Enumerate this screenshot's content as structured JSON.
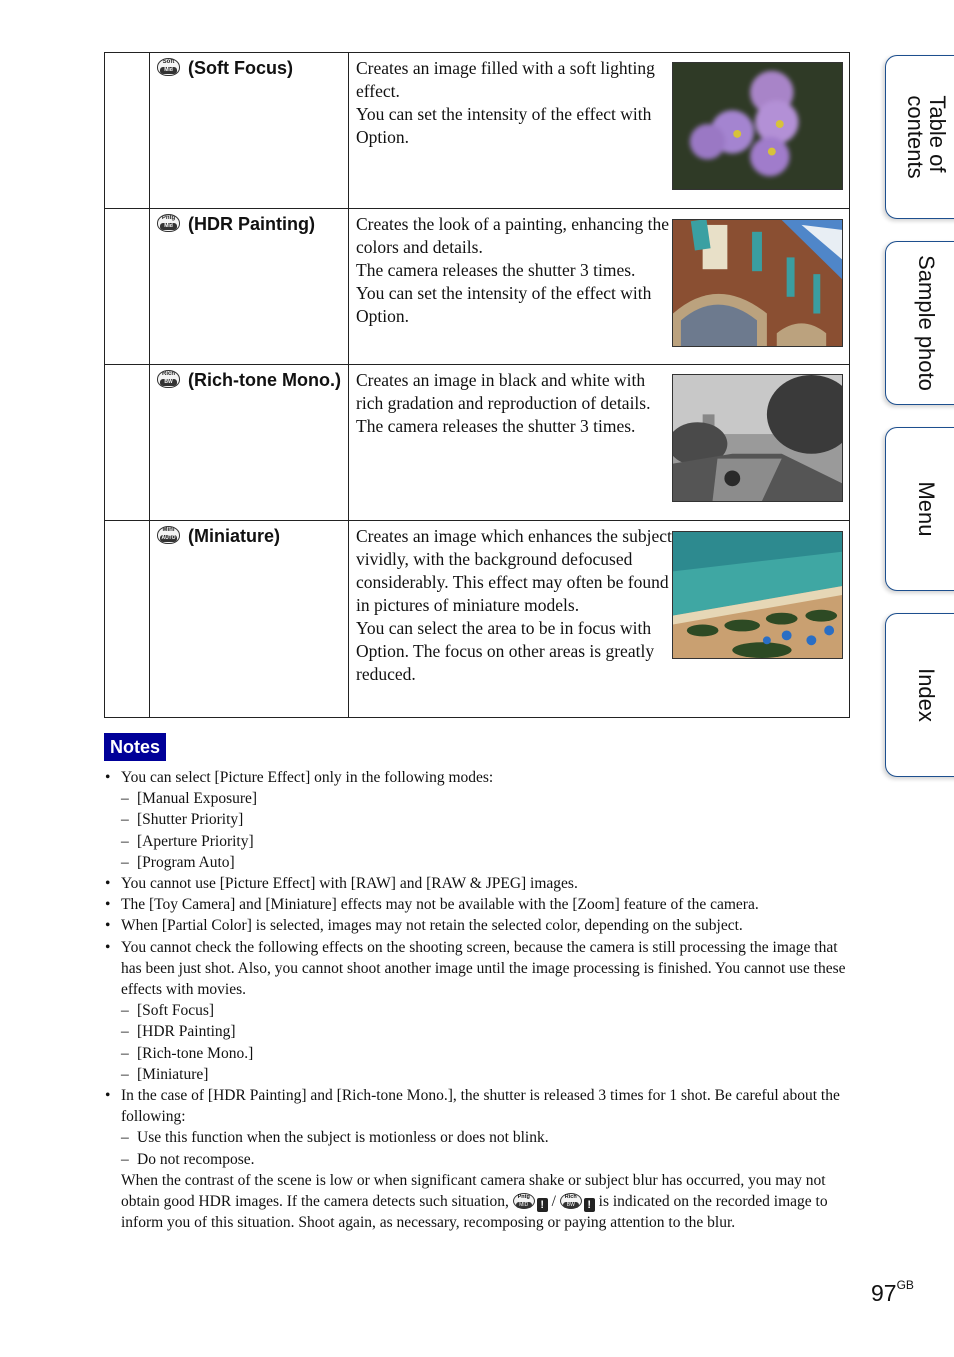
{
  "effects": [
    {
      "name": "(Soft Focus)",
      "icon": "soft-focus-icon",
      "icon_top": "Soft",
      "icon_bottom": "Mid",
      "description": "Creates an image filled with a soft lighting effect.\nYou can set the intensity of the effect with Option.",
      "thumbnail": "purple flowers photo"
    },
    {
      "name": "(HDR Painting)",
      "icon": "hdr-painting-icon",
      "icon_top": "Pntg",
      "icon_bottom": "Mid",
      "description": "Creates the look of a painting, enhancing the colors and details.\nThe camera releases the shutter 3 times.\nYou can set the intensity of the effect with Option.",
      "thumbnail": "building facade photo"
    },
    {
      "name": "(Rich-tone Mono.)",
      "icon": "rich-tone-mono-icon",
      "icon_top": "Rich",
      "icon_bottom": "BW",
      "description": "Creates an image in black and white with rich gradation and reproduction of details. The camera releases the shutter 3 times.",
      "thumbnail": "black and white canal photo"
    },
    {
      "name": "(Miniature)",
      "icon": "miniature-icon",
      "icon_top": "Mini",
      "icon_bottom": "AUTO",
      "description": "Creates an image which enhances the subject vividly, with the background defocused considerably. This effect may often be found in pictures of miniature models.\nYou can select the area to be in focus with Option. The focus on other areas is greatly reduced.",
      "thumbnail": "beach with palm trees photo"
    }
  ],
  "notes": {
    "heading": "Notes",
    "heading_color": "#000099",
    "items": [
      {
        "text": "You can select [Picture Effect] only in the following modes:",
        "sub": [
          "[Manual Exposure]",
          "[Shutter Priority]",
          "[Aperture Priority]",
          "[Program Auto]"
        ]
      },
      {
        "text": "You cannot use [Picture Effect] with [RAW] and [RAW & JPEG] images.",
        "sub": []
      },
      {
        "text": "The [Toy Camera] and [Miniature] effects may not be available with the [Zoom] feature of the camera.",
        "sub": []
      },
      {
        "text": "When [Partial Color] is selected, images may not retain the selected color, depending on the subject.",
        "sub": []
      },
      {
        "text": "You cannot check the following effects on the shooting screen, because the camera is still processing the image that has been just shot. Also, you cannot shoot another image until the image processing is finished. You cannot use these effects with movies.",
        "sub": [
          "[Soft Focus]",
          "[HDR Painting]",
          "[Rich-tone Mono.]",
          "[Miniature]"
        ]
      },
      {
        "text": "In the case of [HDR Painting] and [Rich-tone Mono.], the shutter is released 3 times for 1 shot. Be careful about the following:",
        "sub": [
          "Use this function when the subject is motionless or does not blink.",
          "Do not recompose."
        ],
        "after_before_icons": "When the contrast of the scene is low or when significant camera shake or subject blur has occurred, you may not obtain good HDR images. If the camera detects such situation,",
        "after_icons_separator": "/",
        "after_after_icons": "is indicated on the recorded image to inform you of this situation. Shoot again, as necessary, recomposing or paying attention to the blur."
      }
    ]
  },
  "side_tabs": [
    {
      "label": "Table of\ncontents"
    },
    {
      "label": "Sample photo"
    },
    {
      "label": "Menu"
    },
    {
      "label": "Index"
    }
  ],
  "tab_border_color": "#1d4f8e",
  "page": {
    "number": "97",
    "suffix": "GB"
  }
}
